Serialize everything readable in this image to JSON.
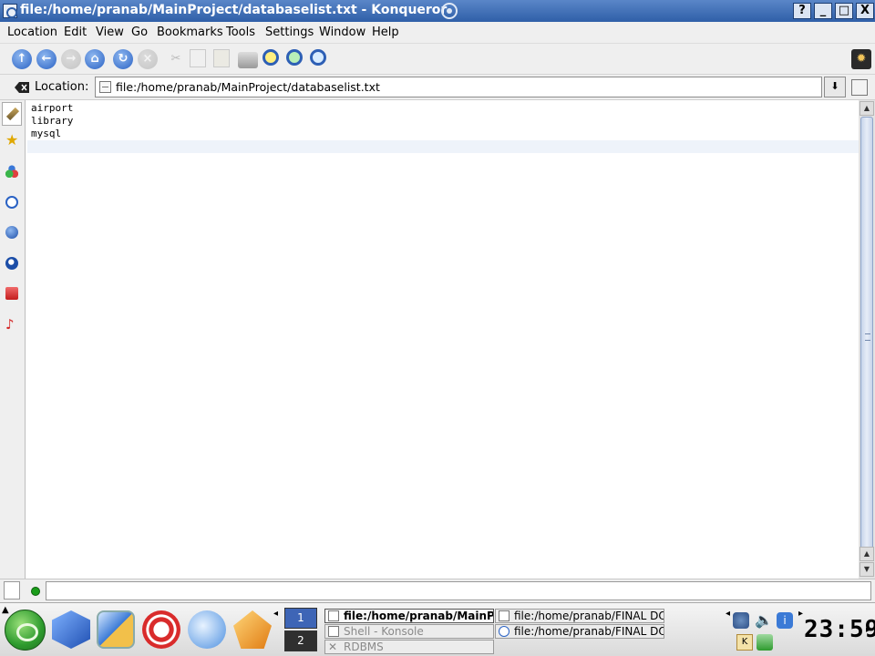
{
  "window": {
    "title": "file:/home/pranab/MainProject/databaselist.txt - Konqueror",
    "buttons": {
      "help": "?",
      "minimize": "_",
      "maximize": "□",
      "close": "X"
    }
  },
  "menu": {
    "items": [
      "Location",
      "Edit",
      "View",
      "Go",
      "Bookmarks",
      "Tools",
      "Settings",
      "Window",
      "Help"
    ]
  },
  "toolbar": {
    "icons": [
      "up-icon",
      "back-icon",
      "forward-icon",
      "home-icon",
      "reload-icon",
      "stop-icon",
      "cut-icon",
      "copy-icon",
      "paste-icon",
      "print-icon",
      "zoom-in-icon",
      "zoom-out-icon",
      "find-icon",
      "throbber-gear-icon"
    ]
  },
  "location_bar": {
    "label": "Location:",
    "url": "file:/home/pranab/MainProject/databaselist.txt"
  },
  "sidebar": {
    "icons": [
      "sidebar-config-icon",
      "bookmarks-star-icon",
      "services-icon",
      "history-icon",
      "network-icon",
      "root-folder-icon",
      "home-folder-icon",
      "media-icon"
    ]
  },
  "document": {
    "lines": [
      "airport",
      "library",
      "mysql"
    ]
  },
  "taskbar": {
    "desktops": [
      "1",
      "2"
    ],
    "tasks": [
      {
        "label": "file:/home/pranab/MainProject",
        "state": "active"
      },
      {
        "label": "file:/home/pranab/FINAL DOC",
        "state": "normal"
      },
      {
        "label": "Shell - Konsole",
        "state": "minimized"
      },
      {
        "label": "file:/home/pranab/FINAL DOC",
        "state": "normal"
      },
      {
        "label": "RDBMS",
        "state": "minimized"
      }
    ],
    "clock": "23:59"
  }
}
